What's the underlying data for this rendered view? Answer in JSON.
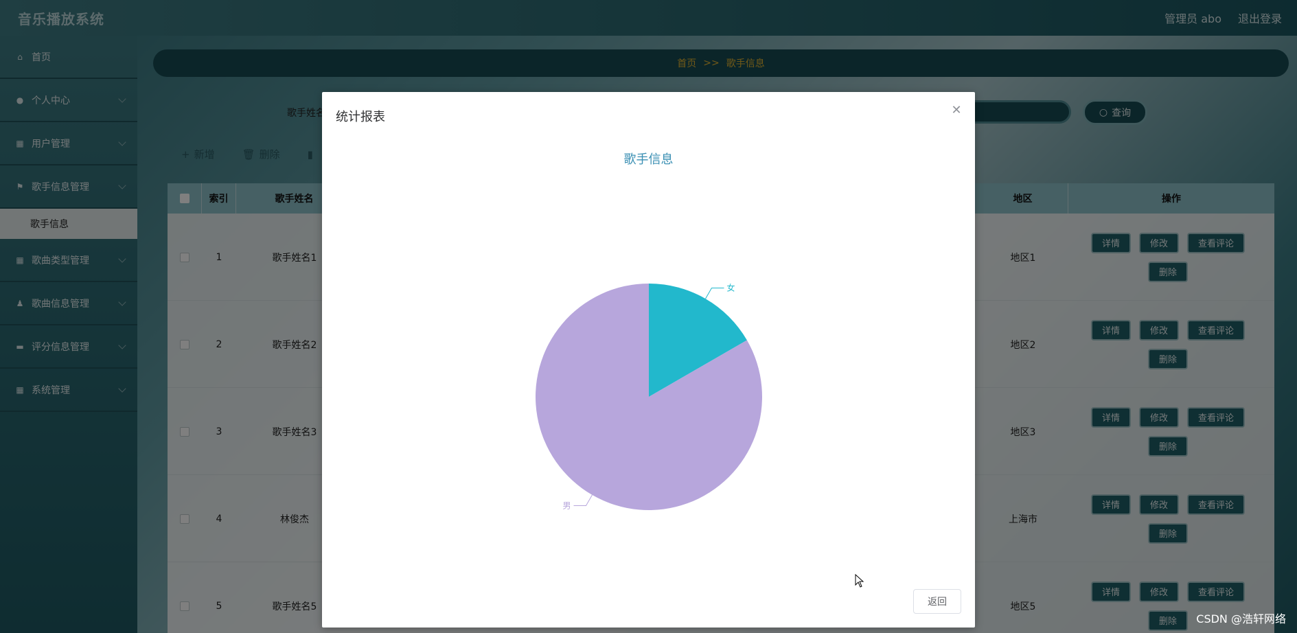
{
  "header": {
    "app_title": "音乐播放系统",
    "user_label": "管理员 abo",
    "logout_label": "退出登录"
  },
  "sidebar": {
    "items": [
      {
        "label": "首页",
        "icon": "home-icon"
      },
      {
        "label": "个人中心",
        "icon": "user-icon"
      },
      {
        "label": "用户管理",
        "icon": "grid-icon"
      },
      {
        "label": "歌手信息管理",
        "icon": "flag-icon"
      },
      {
        "label": "歌曲类型管理",
        "icon": "grid-icon"
      },
      {
        "label": "歌曲信息管理",
        "icon": "person-icon"
      },
      {
        "label": "评分信息管理",
        "icon": "monitor-icon"
      },
      {
        "label": "系统管理",
        "icon": "grid-icon"
      }
    ],
    "submenu": [
      {
        "label": "歌手信息"
      }
    ]
  },
  "breadcrumb": {
    "home": "首页",
    "sep": ">>",
    "current": "歌手信息"
  },
  "search": {
    "label": "歌手姓名",
    "query_label": "查询"
  },
  "toolbar": {
    "add_label": "新增",
    "delete_label": "删除"
  },
  "table": {
    "headers": {
      "index": "索引",
      "name": "歌手姓名",
      "region": "地区",
      "ops": "操作"
    },
    "rows": [
      {
        "index": "1",
        "name": "歌手姓名1",
        "region": "地区1"
      },
      {
        "index": "2",
        "name": "歌手姓名2",
        "region": "地区2"
      },
      {
        "index": "3",
        "name": "歌手姓名3",
        "region": "地区3"
      },
      {
        "index": "4",
        "name": "林俊杰",
        "region": "上海市"
      },
      {
        "index": "5",
        "name": "歌手姓名5",
        "region": "地区5"
      }
    ],
    "ops": {
      "detail": "详情",
      "edit": "修改",
      "comments": "查看评论",
      "delete": "删除"
    }
  },
  "dialog": {
    "title": "统计报表",
    "back_label": "返回"
  },
  "chart_data": {
    "type": "pie",
    "title": "歌手信息",
    "categories": [
      "女",
      "男"
    ],
    "values": [
      1,
      5
    ],
    "colors": [
      "#22b8cc",
      "#b7a6dc"
    ]
  },
  "watermark": "CSDN @浩轩网络"
}
